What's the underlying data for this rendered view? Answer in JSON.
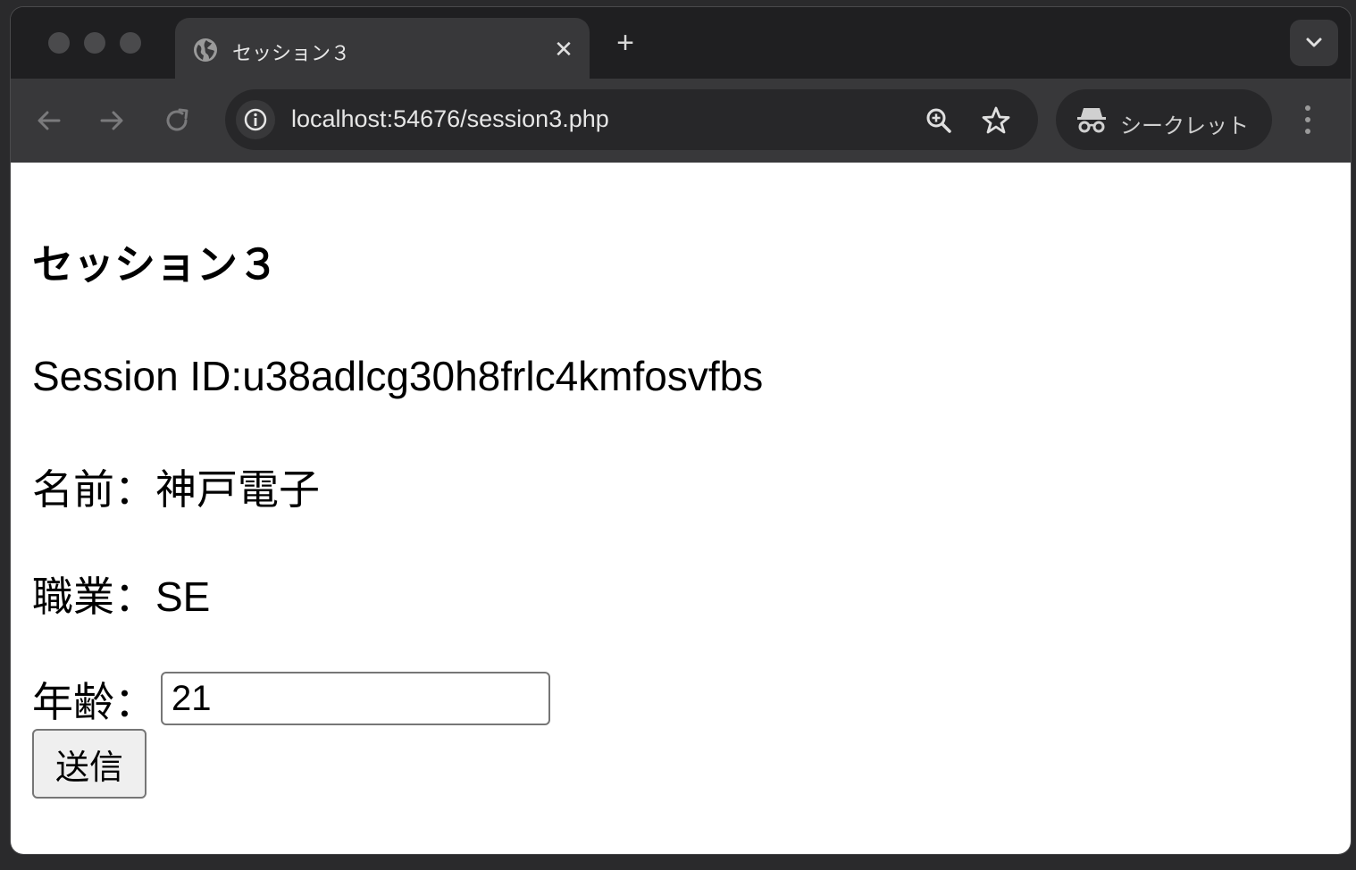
{
  "browser": {
    "tab": {
      "title": "セッション３",
      "close_glyph": "✕",
      "icon": "globe-icon"
    },
    "new_tab_glyph": "+",
    "url": "localhost:54676/session3.php",
    "incognito_label": "シークレット",
    "icons": [
      "back-arrow-icon",
      "forward-arrow-icon",
      "reload-icon",
      "info-icon",
      "zoom-icon",
      "star-icon",
      "incognito-icon",
      "kebab-menu-icon",
      "chevron-down-icon"
    ]
  },
  "page": {
    "title": "セッション３",
    "session_line": "Session ID:u38adlcg30h8frlc4kmfosvfbs",
    "name_line": "名前：神戸電子",
    "job_line": "職業：SE",
    "age_label": "年齢：",
    "age_value": "21",
    "submit_label": "送信"
  },
  "colors": {
    "tabstrip_bg": "#1f1f21",
    "toolbar_bg": "#38383a",
    "omnibox_bg": "#272729",
    "content_bg": "#ffffff"
  }
}
